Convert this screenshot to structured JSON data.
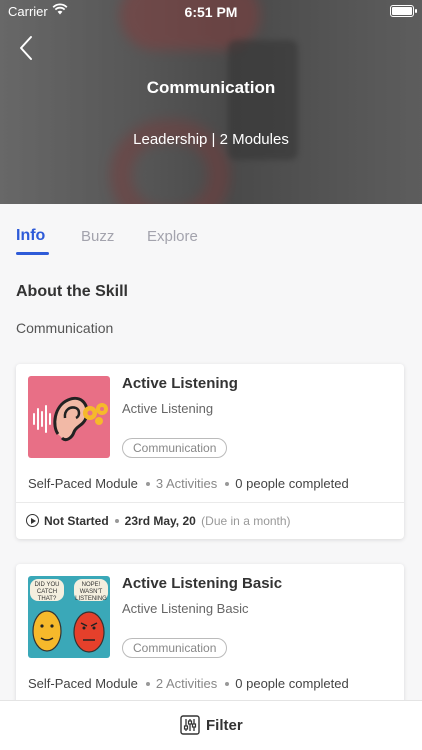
{
  "status_bar": {
    "carrier": "Carrier",
    "time": "6:51 PM"
  },
  "header": {
    "title": "Communication",
    "subtitle": "Leadership | 2 Modules"
  },
  "tabs": [
    {
      "label": "Info",
      "active": true
    },
    {
      "label": "Buzz",
      "active": false
    },
    {
      "label": "Explore",
      "active": false
    }
  ],
  "about": {
    "title": "About the Skill",
    "description": "Communication"
  },
  "modules": [
    {
      "title": "Active Listening",
      "subtitle": "Active Listening",
      "tag": "Communication",
      "type": "Self-Paced Module",
      "activities": "3 Activities",
      "completed": "0 people completed",
      "status": "Not Started",
      "due_date": "23rd May, 20",
      "due_note": "(Due in a month)"
    },
    {
      "title": "Active Listening Basic",
      "subtitle": "Active Listening Basic",
      "tag": "Communication",
      "type": "Self-Paced Module",
      "activities": "2 Activities",
      "completed": "0 people completed",
      "thumb_text": {
        "left_bubble": "DID YOU CATCH THAT?",
        "right_bubble": "NOPE! WASN'T LISTENING"
      }
    }
  ],
  "filter": {
    "label": "Filter"
  },
  "colors": {
    "accent": "#2e5bd8",
    "ear_thumb_bg": "#e86f86",
    "faces_thumb_bg": "#3aa8b8"
  }
}
